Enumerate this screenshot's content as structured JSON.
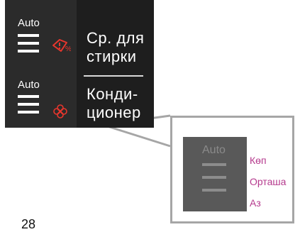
{
  "panel": {
    "rows": [
      {
        "auto_label": "Auto",
        "icon": "detergent-warning-icon",
        "title_line1": "Ср. для",
        "title_line2": "стирки"
      },
      {
        "auto_label": "Auto",
        "icon": "softener-flower-icon",
        "title_line1": "Конди-",
        "title_line2": "ционер"
      }
    ]
  },
  "zoom": {
    "auto_label": "Auto",
    "levels": [
      "Көп",
      "Орташа",
      "Аз"
    ]
  },
  "page_number": "28",
  "colors": {
    "panel_bg": "#1e1e1e",
    "column_bg": "#2b2b2b",
    "icon_red": "#e8362d",
    "level_text": "#b53a8d",
    "callout_border": "#a6a6a6"
  }
}
